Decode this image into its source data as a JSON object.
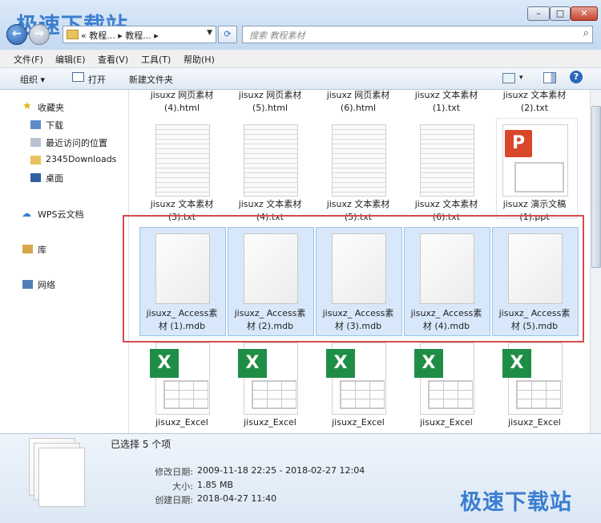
{
  "watermark": "极速下载站",
  "window": {
    "min": "–",
    "max": "□",
    "close": "✕"
  },
  "nav": {
    "back": "←",
    "fwd": "→"
  },
  "address": {
    "path": "« 教程... ▸ 教程... ▸",
    "refresh": "⟳"
  },
  "search": {
    "placeholder": "搜索 教程素材",
    "icon": "search-icon"
  },
  "menu": [
    "文件(F)",
    "编辑(E)",
    "查看(V)",
    "工具(T)",
    "帮助(H)"
  ],
  "toolbar": {
    "organize": "组织 ▾",
    "open": "打开",
    "new_folder": "新建文件夹",
    "view": "▾",
    "help": "?"
  },
  "sidebar": {
    "favorites": "收藏夹",
    "items": [
      "下载",
      "最近访问的位置",
      "2345Downloads",
      "桌面"
    ],
    "wps": "WPS云文档",
    "library": "库",
    "network": "网络"
  },
  "files": {
    "row1": [
      "jisuxz 网页素材\n(4).html",
      "jisuxz 网页素材\n(5).html",
      "jisuxz 网页素材\n(6).html",
      "jisuxz 文本素材\n(1).txt",
      "jisuxz 文本素材\n(2).txt"
    ],
    "row2": [
      "jisuxz 文本素材\n(3).txt",
      "jisuxz 文本素材\n(4).txt",
      "jisuxz 文本素材\n(5).txt",
      "jisuxz 文本素材\n(6).txt",
      "jisuxz 演示文稿\n(1).ppt"
    ],
    "row3": [
      "jisuxz_ Access素\n材 (1).mdb",
      "jisuxz_ Access素\n材 (2).mdb",
      "jisuxz_ Access素\n材 (3).mdb",
      "jisuxz_ Access素\n材 (4).mdb",
      "jisuxz_ Access素\n材 (5).mdb"
    ],
    "row4": [
      "jisuxz_Excel",
      "jisuxz_Excel",
      "jisuxz_Excel",
      "jisuxz_Excel",
      "jisuxz_Excel"
    ],
    "excel_letter": "X"
  },
  "details": {
    "selected": "已选择 5 个项",
    "modified_label": "修改日期:",
    "modified": "2009-11-18 22:25 - 2018-02-27 12:04",
    "size_label": "大小:",
    "size": "1.85 MB",
    "created_label": "创建日期:",
    "created": "2018-04-27 11:40"
  },
  "colors": {
    "selection": "#d8e8fa",
    "highlight_box": "#d64a4a",
    "excel": "#1f8e45",
    "ppt": "#d9472b",
    "watermark": "#3b7ed0"
  }
}
